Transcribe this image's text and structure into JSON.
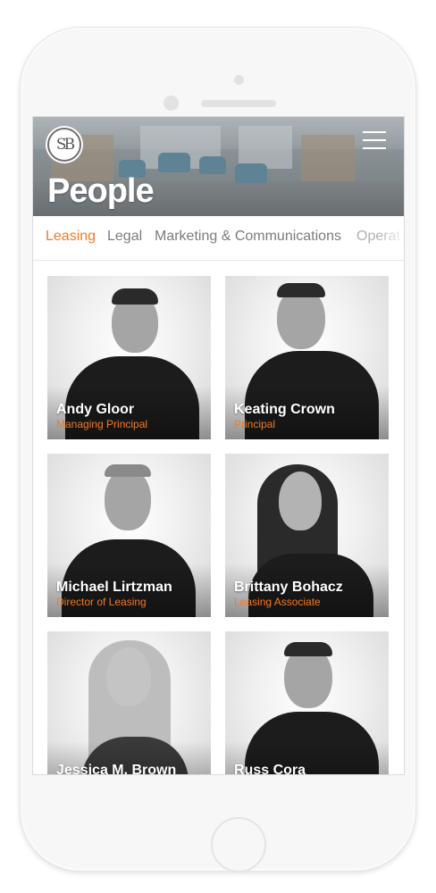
{
  "header": {
    "logo_text": "SB",
    "title": "People"
  },
  "tabs": [
    {
      "label": "Leasing",
      "active": true
    },
    {
      "label": "Legal",
      "active": false
    },
    {
      "label": "Marketing & Communications",
      "active": false
    },
    {
      "label": "Operat",
      "active": false
    }
  ],
  "people": [
    {
      "name": "Andy Gloor",
      "role": "Managing Principal"
    },
    {
      "name": "Keating Crown",
      "role": "Principal"
    },
    {
      "name": "Michael Lirtzman",
      "role": "Director of Leasing"
    },
    {
      "name": "Brittany Bohacz",
      "role": "Leasing Associate"
    },
    {
      "name": "Jessica M. Brown",
      "role": ""
    },
    {
      "name": "Russ Cora",
      "role": ""
    }
  ],
  "colors": {
    "accent": "#f47a22",
    "tab_inactive": "#7b7b7b",
    "title": "#ffffff"
  },
  "icons": [
    "logo-icon",
    "hamburger-menu-icon"
  ]
}
